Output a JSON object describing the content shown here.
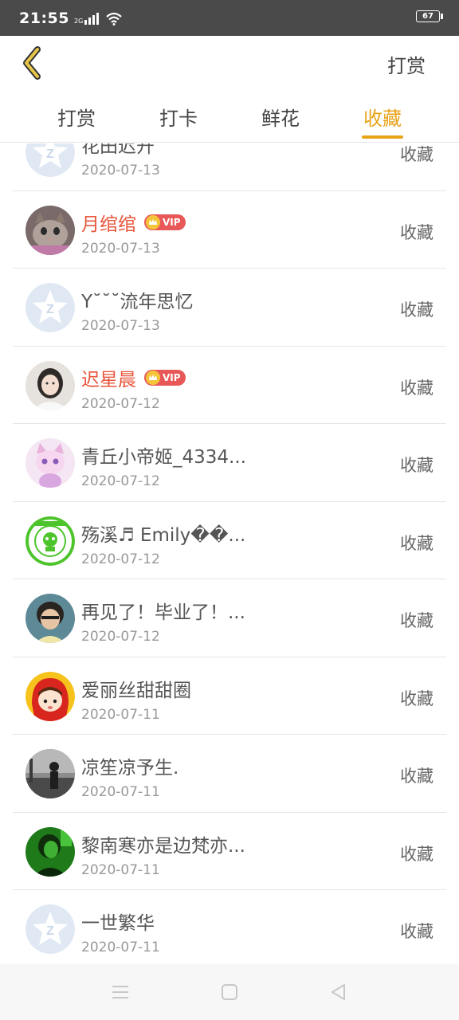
{
  "status_bar": {
    "time": "21:55",
    "network": "2G",
    "battery": "67"
  },
  "header": {
    "back_icon": "chevron-left-icon",
    "action_label": "打赏"
  },
  "tabs": [
    {
      "label": "打赏",
      "active": false
    },
    {
      "label": "打卡",
      "active": false
    },
    {
      "label": "鲜花",
      "active": false
    },
    {
      "label": "收藏",
      "active": true
    }
  ],
  "list": [
    {
      "name": "花田迟开",
      "date": "2020-07-13",
      "action": "收藏",
      "vip": false,
      "avatar": "default-avatar"
    },
    {
      "name": "月绾绾",
      "date": "2020-07-13",
      "action": "收藏",
      "vip": true,
      "vip_label": "VIP",
      "avatar": "cat-photo"
    },
    {
      "name": "Y˘˘˘流年思忆",
      "date": "2020-07-13",
      "action": "收藏",
      "vip": false,
      "avatar": "default-avatar"
    },
    {
      "name": "迟星晨",
      "date": "2020-07-12",
      "action": "收藏",
      "vip": true,
      "vip_label": "VIP",
      "avatar": "woman-photo"
    },
    {
      "name": "青丘小帝姬_4334...",
      "date": "2020-07-12",
      "action": "收藏",
      "vip": false,
      "avatar": "pink-cat-illustration"
    },
    {
      "name": "殇溪♬ Emily��...",
      "date": "2020-07-12",
      "action": "收藏",
      "vip": false,
      "avatar": "green-badge"
    },
    {
      "name": "再见了！毕业了！...",
      "date": "2020-07-12",
      "action": "收藏",
      "vip": false,
      "avatar": "child-photo"
    },
    {
      "name": "爱丽丝甜甜圈",
      "date": "2020-07-11",
      "action": "收藏",
      "vip": false,
      "avatar": "red-hood-cartoon"
    },
    {
      "name": "凉笙凉予生.",
      "date": "2020-07-11",
      "action": "收藏",
      "vip": false,
      "avatar": "street-photo"
    },
    {
      "name": "黎南寒亦是边梵亦...",
      "date": "2020-07-11",
      "action": "收藏",
      "vip": false,
      "avatar": "green-portrait"
    },
    {
      "name": "一世繁华",
      "date": "2020-07-11",
      "action": "收藏",
      "vip": false,
      "avatar": "default-avatar"
    }
  ],
  "nav_bar": {
    "buttons": [
      "menu-icon",
      "home-icon",
      "back-icon"
    ]
  },
  "colors": {
    "accent": "#e8a317",
    "vip_name": "#e8563b",
    "vip_badge": "#e85858"
  }
}
